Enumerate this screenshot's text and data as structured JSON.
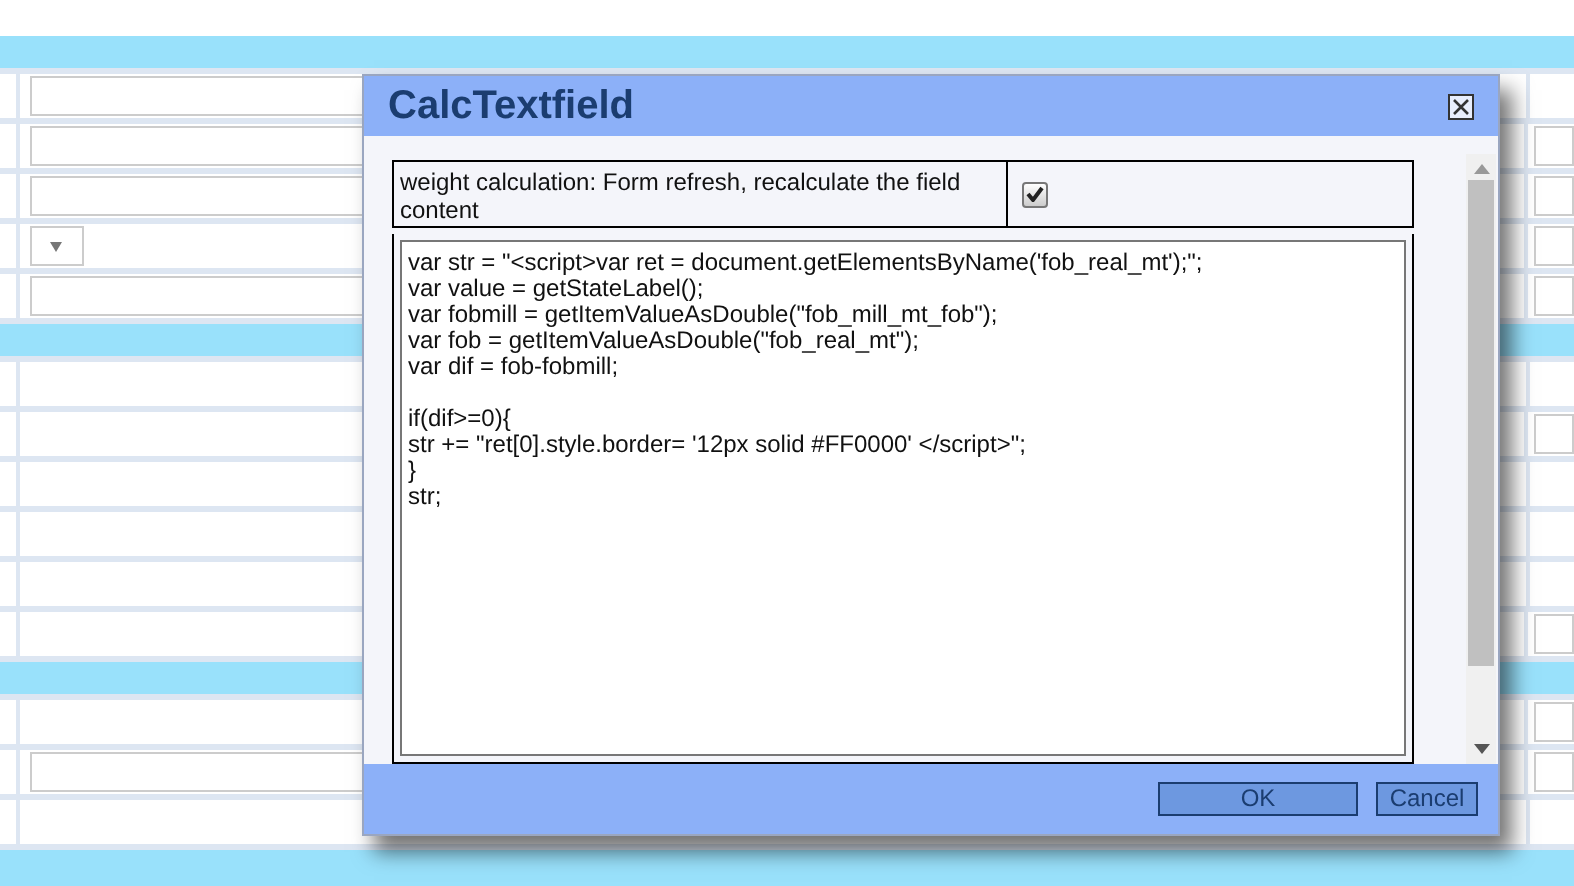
{
  "background_form": {
    "sections": [
      {
        "rows": [
          {
            "kind": "textbox",
            "right_field": false
          },
          {
            "kind": "textbox",
            "right_field": true
          },
          {
            "kind": "textbox",
            "right_field": true
          },
          {
            "kind": "dropdown",
            "right_field": true
          },
          {
            "kind": "textbox",
            "right_field": true
          }
        ]
      },
      {
        "rows": [
          {
            "kind": "blank",
            "right_field": false
          },
          {
            "kind": "blank",
            "right_field": true
          },
          {
            "kind": "blank",
            "right_field": false
          },
          {
            "kind": "blank",
            "right_field": false
          },
          {
            "kind": "blank",
            "right_field": false
          },
          {
            "kind": "blank",
            "right_field": true
          }
        ]
      },
      {
        "rows": [
          {
            "kind": "blank",
            "right_field": true
          },
          {
            "kind": "textbox",
            "right_field": true
          },
          {
            "kind": "blank",
            "right_field": false
          }
        ]
      }
    ]
  },
  "dialog": {
    "title": "CalcTextfield",
    "option": {
      "label": "weight calculation: Form refresh, recalculate the field content",
      "checked": true
    },
    "code": "var str = \"<script>var ret = document.getElementsByName('fob_real_mt');\";\nvar value = getStateLabel();\nvar fobmill = getItemValueAsDouble(\"fob_mill_mt_fob\");\nvar fob = getItemValueAsDouble(\"fob_real_mt\");\nvar dif = fob-fobmill;\n\nif(dif>=0){\nstr += \"ret[0].style.border= '12px solid #FF0000' </script>\";\n}\nstr;",
    "buttons": [
      {
        "label": "OK",
        "kind": "primary"
      },
      {
        "label": "Cancel",
        "kind": "secondary"
      }
    ]
  }
}
